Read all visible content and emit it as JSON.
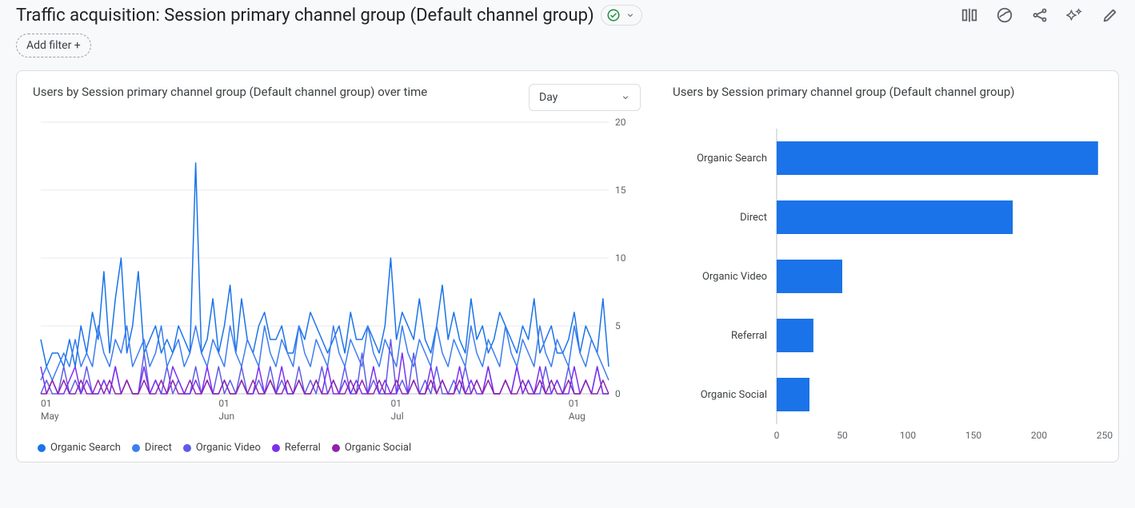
{
  "header": {
    "title": "Traffic acquisition: Session primary channel group (Default channel group)",
    "status_icon": "verified-check",
    "add_filter_label": "Add filter +"
  },
  "toolbar_icons": [
    "compare-icon",
    "insights-icon",
    "share-icon",
    "sparkle-icon",
    "edit-icon"
  ],
  "left_panel": {
    "title": "Users by Session primary channel group (Default channel group) over time",
    "granularity_selected": "Day"
  },
  "right_panel": {
    "title": "Users by Session primary channel group (Default channel group)"
  },
  "colors": {
    "organic_search": "#1a73e8",
    "direct": "#3c7df0",
    "organic_video": "#5e5ce6",
    "referral": "#7b2ff2",
    "organic_social": "#8e24aa",
    "bar": "#1a73e8"
  },
  "legend": [
    "Organic Search",
    "Direct",
    "Organic Video",
    "Referral",
    "Organic Social"
  ],
  "chart_data": [
    {
      "id": "line_over_time",
      "type": "line",
      "title": "Users by Session primary channel group (Default channel group) over time",
      "xlabel": "",
      "ylabel": "",
      "ylim": [
        0,
        20
      ],
      "yticks": [
        0,
        5,
        10,
        15,
        20
      ],
      "x_tick_labels": [
        "01\nMay",
        "01\nJun",
        "01\nJul",
        "01\nAug"
      ],
      "x_tick_idx": [
        0,
        31,
        61,
        92
      ],
      "n_points": 100,
      "series": [
        {
          "name": "Organic Search",
          "color": "#1a73e8",
          "values": [
            4,
            2,
            3,
            3,
            2,
            4,
            2,
            5,
            3,
            6,
            4,
            9,
            3,
            7,
            10,
            3,
            5,
            9,
            3,
            4,
            5,
            3,
            4,
            3,
            5,
            4,
            3,
            17,
            3,
            4,
            7,
            3,
            5,
            8,
            3,
            7,
            4,
            3,
            5,
            6,
            4,
            4,
            5,
            3,
            3,
            5,
            4,
            6,
            5,
            4,
            3,
            4,
            5,
            3,
            6,
            4,
            4,
            5,
            4,
            3,
            5,
            10,
            4,
            6,
            5,
            4,
            7,
            4,
            3,
            5,
            8,
            4,
            6,
            4,
            3,
            7,
            4,
            5,
            3,
            4,
            6,
            5,
            4,
            3,
            5,
            4,
            7,
            3,
            4,
            5,
            3,
            3,
            4,
            6,
            3,
            5,
            4,
            3,
            7,
            2
          ]
        },
        {
          "name": "Direct",
          "color": "#3c7df0",
          "values": [
            1,
            2,
            1,
            2,
            3,
            2,
            4,
            2,
            3,
            2,
            5,
            3,
            2,
            4,
            3,
            5,
            2,
            3,
            4,
            2,
            3,
            5,
            2,
            3,
            4,
            2,
            3,
            5,
            3,
            2,
            4,
            3,
            2,
            5,
            3,
            2,
            4,
            3,
            2,
            5,
            3,
            2,
            4,
            3,
            2,
            5,
            3,
            2,
            4,
            3,
            2,
            5,
            3,
            2,
            4,
            3,
            2,
            5,
            3,
            2,
            4,
            3,
            2,
            5,
            3,
            2,
            4,
            3,
            2,
            5,
            3,
            2,
            4,
            3,
            2,
            5,
            3,
            2,
            4,
            3,
            2,
            5,
            3,
            2,
            4,
            3,
            2,
            5,
            3,
            2,
            4,
            3,
            2,
            5,
            3,
            2,
            4,
            3,
            2,
            1
          ]
        },
        {
          "name": "Organic Video",
          "color": "#5e5ce6",
          "values": [
            0,
            1,
            0,
            0,
            2,
            0,
            1,
            0,
            2,
            0,
            0,
            1,
            0,
            2,
            0,
            1,
            0,
            0,
            3,
            0,
            1,
            0,
            2,
            0,
            1,
            0,
            0,
            2,
            0,
            1,
            0,
            2,
            0,
            1,
            0,
            2,
            0,
            0,
            1,
            0,
            2,
            0,
            1,
            0,
            0,
            2,
            0,
            1,
            0,
            2,
            0,
            1,
            0,
            2,
            0,
            0,
            3,
            0,
            1,
            0,
            0,
            4,
            0,
            1,
            0,
            3,
            0,
            1,
            0,
            2,
            0,
            0,
            1,
            0,
            2,
            0,
            1,
            0,
            2,
            0,
            0,
            1,
            0,
            2,
            0,
            1,
            0,
            0,
            2,
            0,
            1,
            0,
            2,
            0,
            0,
            1,
            0,
            2,
            0,
            0
          ]
        },
        {
          "name": "Referral",
          "color": "#7b2ff2",
          "values": [
            2,
            0,
            1,
            0,
            0,
            1,
            2,
            0,
            1,
            0,
            0,
            1,
            0,
            2,
            0,
            1,
            0,
            0,
            2,
            0,
            1,
            0,
            0,
            2,
            1,
            0,
            0,
            1,
            0,
            2,
            0,
            0,
            1,
            0,
            0,
            1,
            0,
            0,
            2,
            0,
            1,
            0,
            2,
            0,
            0,
            1,
            0,
            0,
            1,
            0,
            2,
            0,
            0,
            1,
            0,
            1,
            0,
            0,
            2,
            0,
            1,
            0,
            0,
            3,
            0,
            1,
            0,
            0,
            2,
            0,
            1,
            0,
            0,
            2,
            0,
            1,
            0,
            0,
            2,
            0,
            0,
            1,
            0,
            2,
            0,
            1,
            0,
            2,
            0,
            0,
            1,
            0,
            0,
            2,
            0,
            1,
            0,
            2,
            0,
            0
          ]
        },
        {
          "name": "Organic Social",
          "color": "#8e24aa",
          "values": [
            0,
            0,
            1,
            0,
            1,
            0,
            0,
            1,
            0,
            0,
            1,
            0,
            1,
            0,
            0,
            1,
            0,
            0,
            1,
            0,
            0,
            1,
            0,
            1,
            0,
            0,
            1,
            0,
            0,
            1,
            0,
            0,
            1,
            0,
            0,
            1,
            0,
            1,
            0,
            0,
            1,
            0,
            0,
            1,
            0,
            1,
            0,
            0,
            1,
            0,
            0,
            1,
            0,
            0,
            1,
            0,
            1,
            0,
            0,
            1,
            0,
            0,
            1,
            0,
            0,
            1,
            0,
            0,
            1,
            0,
            1,
            0,
            0,
            1,
            0,
            0,
            1,
            0,
            1,
            0,
            0,
            1,
            0,
            0,
            1,
            0,
            0,
            1,
            0,
            1,
            0,
            0,
            1,
            0,
            0,
            1,
            0,
            0,
            1,
            0
          ]
        }
      ]
    },
    {
      "id": "bar_totals",
      "type": "bar",
      "orientation": "horizontal",
      "title": "Users by Session primary channel group (Default channel group)",
      "xlim": [
        0,
        250
      ],
      "xticks": [
        0,
        50,
        100,
        150,
        200,
        250
      ],
      "categories": [
        "Organic Search",
        "Direct",
        "Organic Video",
        "Referral",
        "Organic Social"
      ],
      "values": [
        245,
        180,
        50,
        28,
        25
      ]
    }
  ]
}
